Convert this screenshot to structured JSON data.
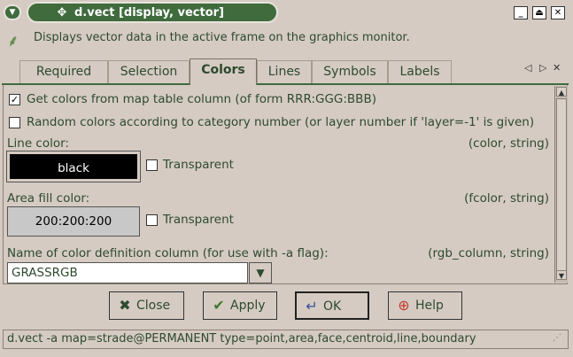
{
  "window": {
    "title": "d.vect [display, vector]",
    "controls": [
      "minimize-icon",
      "maximize-icon",
      "close-icon"
    ]
  },
  "description": "Displays vector data in the active frame on the graphics monitor.",
  "tabs": [
    {
      "label": "Required",
      "active": false
    },
    {
      "label": "Selection",
      "active": false
    },
    {
      "label": "Colors",
      "active": true
    },
    {
      "label": "Lines",
      "active": false
    },
    {
      "label": "Symbols",
      "active": false
    },
    {
      "label": "Labels",
      "active": false
    }
  ],
  "options": {
    "table_colors": {
      "label": "Get colors from map table column (of form RRR:GGG:BBB)",
      "checked": true
    },
    "random_colors": {
      "label": "Random colors according to category number (or layer number if 'layer=-1' is given)",
      "checked": false
    },
    "line_color": {
      "label": "Line color:",
      "hint": "(color, string)",
      "value": "black",
      "transparent_label": "Transparent",
      "transparent": false
    },
    "area_color": {
      "label": "Area fill color:",
      "hint": "(fcolor, string)",
      "value": "200:200:200",
      "transparent_label": "Transparent",
      "transparent": false
    },
    "rgb_column": {
      "label": "Name of color definition column (for use with -a flag):",
      "hint": "(rgb_column, string)",
      "value": "GRASSRGB"
    }
  },
  "buttons": {
    "close": "Close",
    "apply": "Apply",
    "ok": "OK",
    "help": "Help"
  },
  "status": "d.vect -a map=strade@PERMANENT type=point,area,face,centroid,line,boundary",
  "colors": {
    "accent": "#3f6b3d",
    "background": "#d5cbc2",
    "line_color_swatch": "#000000",
    "area_color_swatch": "#c8c8c8"
  }
}
